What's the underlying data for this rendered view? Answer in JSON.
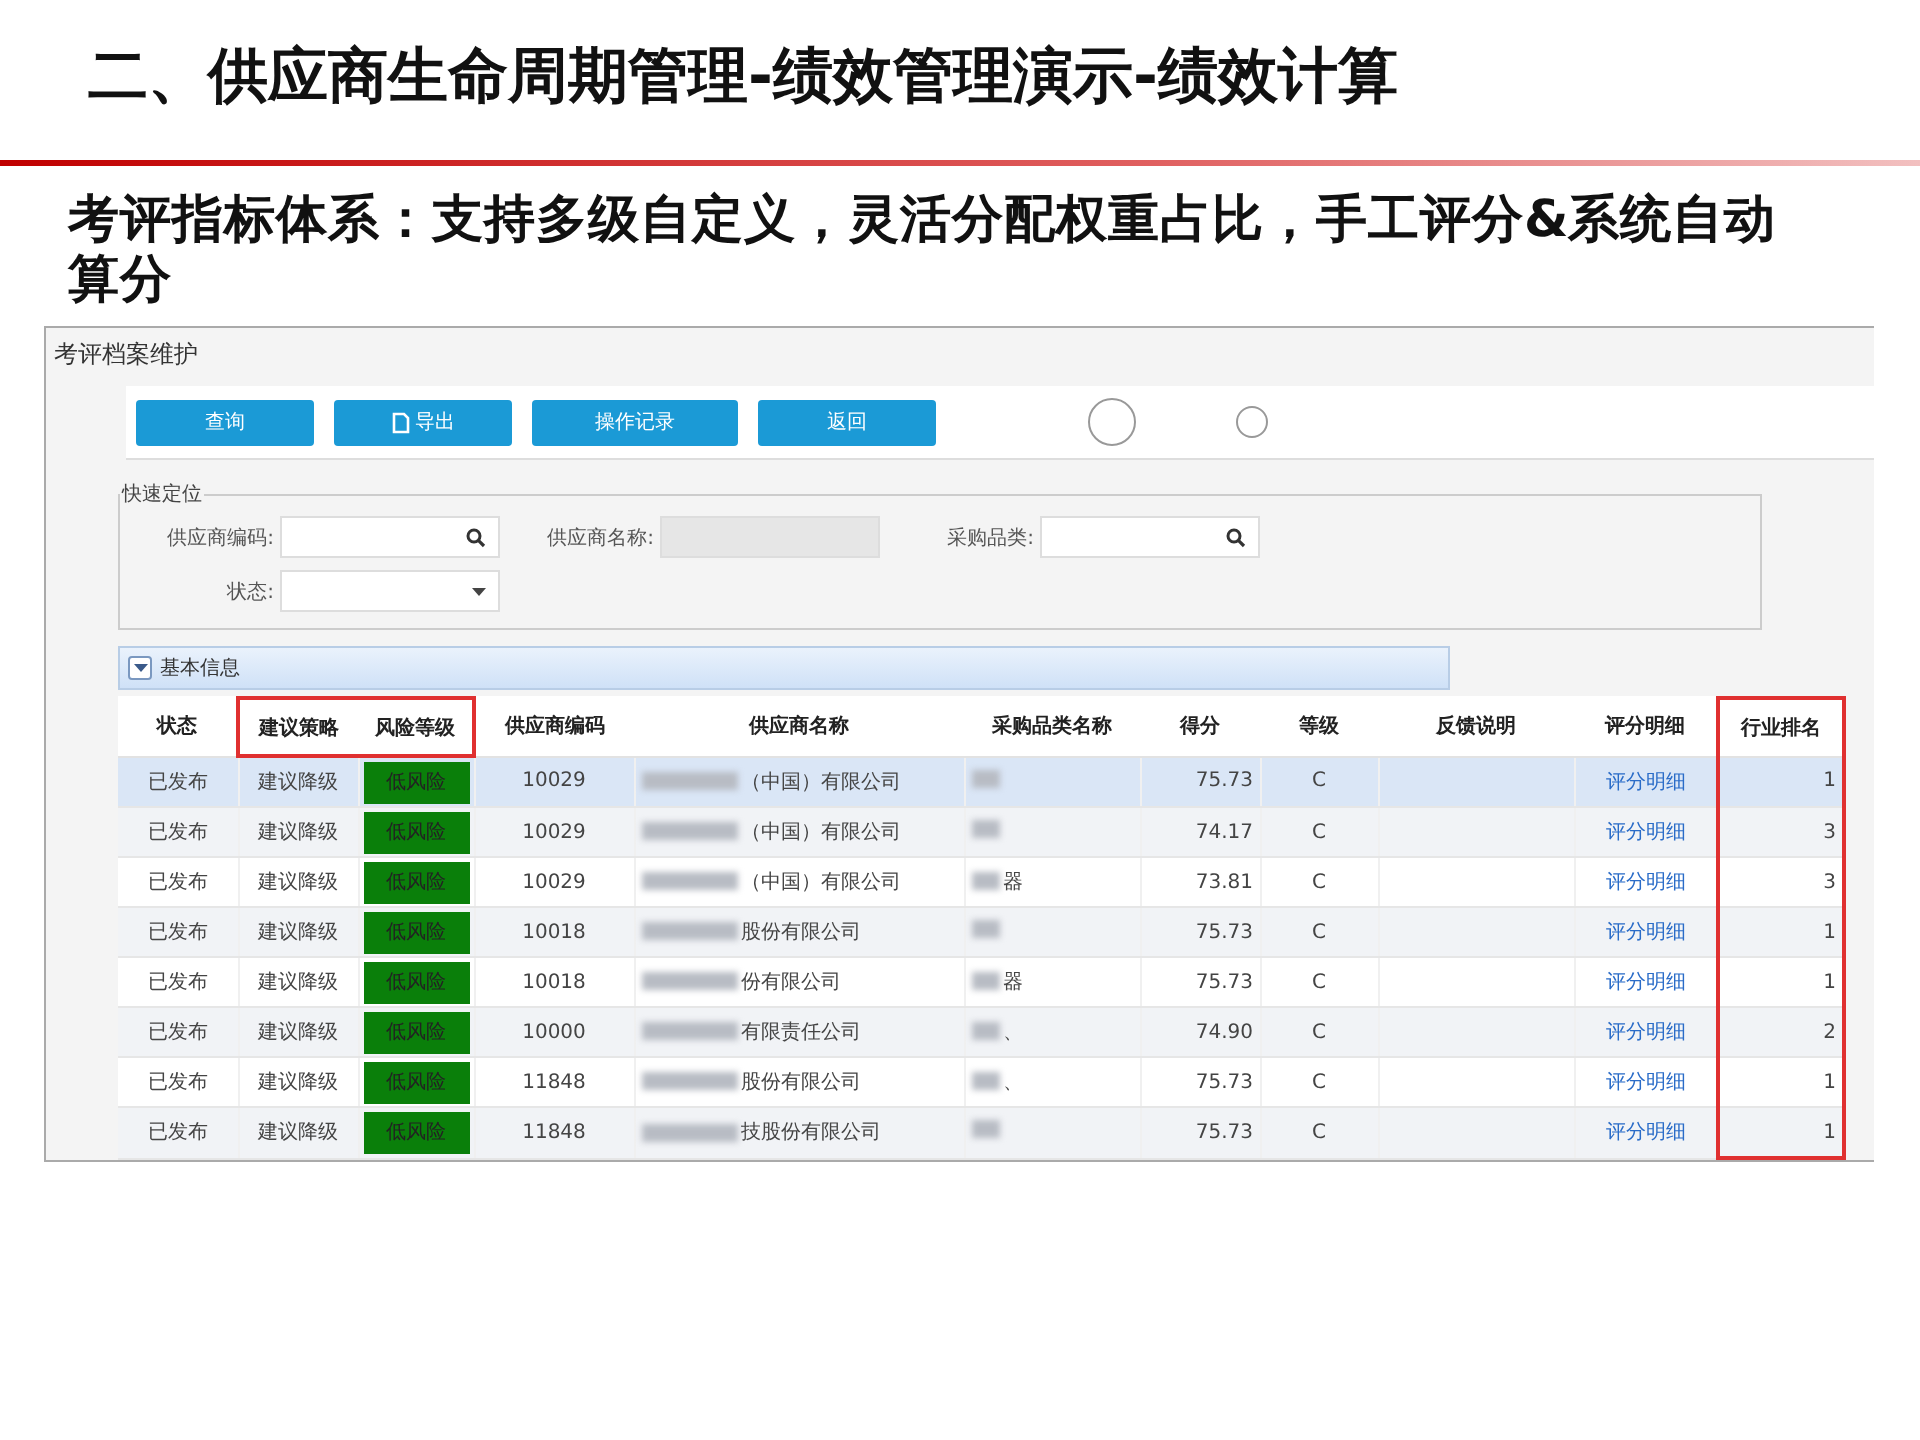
{
  "slide": {
    "title": "二、供应商生命周期管理-绩效管理演示-绩效计算",
    "subtitle": "考评指标体系：支持多级自定义，灵活分配权重占比，手工评分&系统自动算分"
  },
  "window": {
    "title": "考评档案维护"
  },
  "toolbar": [
    {
      "label": "查询",
      "icon": false
    },
    {
      "label": "导出",
      "icon": true
    },
    {
      "label": "操作记录",
      "icon": false
    },
    {
      "label": "返回",
      "icon": false
    }
  ],
  "quick_search": {
    "legend": "快速定位",
    "fields": [
      {
        "label": "供应商编码:",
        "kind": "search",
        "disabled": false
      },
      {
        "label": "供应商名称:",
        "kind": "text",
        "disabled": true
      },
      {
        "label": "采购品类:",
        "kind": "search",
        "disabled": false
      },
      {
        "label": "状态:",
        "kind": "select",
        "disabled": false
      }
    ]
  },
  "section": {
    "title": "基本信息",
    "expanded": true
  },
  "table": {
    "columns": [
      {
        "label": "状态",
        "header_highlighted": false,
        "column_highlighted": false
      },
      {
        "label": "建议策略",
        "header_highlighted": true,
        "column_highlighted": false
      },
      {
        "label": "风险等级",
        "header_highlighted": true,
        "column_highlighted": false
      },
      {
        "label": "供应商编码",
        "header_highlighted": false,
        "column_highlighted": false
      },
      {
        "label": "供应商名称",
        "header_highlighted": false,
        "column_highlighted": false
      },
      {
        "label": "采购品类名称",
        "header_highlighted": false,
        "column_highlighted": false
      },
      {
        "label": "得分",
        "header_highlighted": false,
        "column_highlighted": false
      },
      {
        "label": "等级",
        "header_highlighted": false,
        "column_highlighted": false
      },
      {
        "label": "反馈说明",
        "header_highlighted": false,
        "column_highlighted": false
      },
      {
        "label": "评分明细",
        "header_highlighted": false,
        "column_highlighted": false
      },
      {
        "label": "行业排名",
        "header_highlighted": false,
        "column_highlighted": true
      }
    ],
    "rows": [
      {
        "selected": true,
        "status": "已发布",
        "strategy": "建议降级",
        "risk": "低风险",
        "code": "10029",
        "name": "（中国）有限公司",
        "score": "75.73",
        "grade": "C",
        "link": "评分明细",
        "rank": "1"
      },
      {
        "selected": false,
        "status": "已发布",
        "strategy": "建议降级",
        "risk": "低风险",
        "code": "10029",
        "name": "（中国）有限公司",
        "score": "74.17",
        "grade": "C",
        "link": "评分明细",
        "rank": "3"
      },
      {
        "selected": false,
        "status": "已发布",
        "strategy": "建议降级",
        "risk": "低风险",
        "code": "10029",
        "name": "（中国）有限公司",
        "category": "器",
        "score": "73.81",
        "grade": "C",
        "link": "评分明细",
        "rank": "3"
      },
      {
        "selected": false,
        "status": "已发布",
        "strategy": "建议降级",
        "risk": "低风险",
        "code": "10018",
        "name": "股份有限公司",
        "score": "75.73",
        "grade": "C",
        "link": "评分明细",
        "rank": "1"
      },
      {
        "selected": false,
        "status": "已发布",
        "strategy": "建议降级",
        "risk": "低风险",
        "code": "10018",
        "name": "份有限公司",
        "category": "器",
        "score": "75.73",
        "grade": "C",
        "link": "评分明细",
        "rank": "1"
      },
      {
        "selected": false,
        "status": "已发布",
        "strategy": "建议降级",
        "risk": "低风险",
        "code": "10000",
        "name": "有限责任公司",
        "category": "、",
        "score": "74.90",
        "grade": "C",
        "link": "评分明细",
        "rank": "2"
      },
      {
        "selected": false,
        "status": "已发布",
        "strategy": "建议降级",
        "risk": "低风险",
        "code": "11848",
        "name": "股份有限公司",
        "category": "、",
        "score": "75.73",
        "grade": "C",
        "link": "评分明细",
        "rank": "1"
      },
      {
        "selected": false,
        "status": "已发布",
        "strategy": "建议降级",
        "risk": "低风险",
        "code": "11848",
        "name": "技股份有限公司",
        "score": "75.73",
        "grade": "C",
        "link": "评分明细",
        "rank": "1"
      }
    ]
  }
}
